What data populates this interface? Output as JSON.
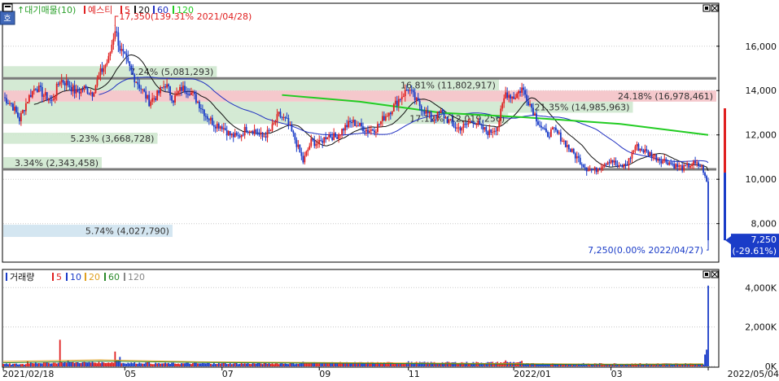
{
  "price_panel": {
    "legend_prefix": "↑대기매물(10)",
    "stock_name": "예스티",
    "legend_ma": [
      "5",
      "20",
      "60",
      "120"
    ],
    "high_label": "17,350(139.31% 2021/04/28)",
    "low_label": "7,250(0.00% 2022/04/27)",
    "last_price": "7,250",
    "last_change": "(-29.61%)",
    "corner_icon": "hoga-icon",
    "corner_label": "호"
  },
  "volume_panel": {
    "legend_title": "거래량",
    "legend_ma": [
      "5",
      "10",
      "20",
      "60",
      "120"
    ]
  },
  "colors": {
    "up": "#e02020",
    "down": "#1a3cc8",
    "ma5": "#e02020",
    "ma20": "#111111",
    "ma60": "#1f2fc0",
    "ma120": "#22cc22",
    "supply_band": "#cfe8cf",
    "supply_hot": "#f4c2c6",
    "supply_low": "#cfe3f0"
  },
  "chart_data": [
    {
      "type": "line",
      "panel": "price",
      "y_ticks": [
        8000,
        10000,
        12000,
        14000,
        16000
      ],
      "y_tick_labels": [
        "8,000",
        "10,000",
        "12,000",
        "14,000",
        "16,000"
      ],
      "ylim": [
        6300,
        17900
      ],
      "x_labels": [
        "2021/02/18",
        "05",
        "07",
        "09",
        "11",
        "2022/01",
        "03",
        "2022/05/04"
      ],
      "x_label_days": [
        0,
        75,
        135,
        195,
        250,
        315,
        375,
        435
      ],
      "x_range": [
        0,
        440
      ],
      "key_prices": [
        {
          "day": 0,
          "close": 13700
        },
        {
          "day": 5,
          "close": 13400
        },
        {
          "day": 10,
          "close": 12700
        },
        {
          "day": 15,
          "close": 13600
        },
        {
          "day": 20,
          "close": 14200
        },
        {
          "day": 25,
          "close": 13800
        },
        {
          "day": 30,
          "close": 13500
        },
        {
          "day": 35,
          "close": 14500
        },
        {
          "day": 40,
          "close": 14300
        },
        {
          "day": 45,
          "close": 13900
        },
        {
          "day": 50,
          "close": 14100
        },
        {
          "day": 55,
          "close": 13900
        },
        {
          "day": 60,
          "close": 14800
        },
        {
          "day": 65,
          "close": 15400
        },
        {
          "day": 69,
          "close": 16800
        },
        {
          "day": 72,
          "close": 15900
        },
        {
          "day": 76,
          "close": 15300
        },
        {
          "day": 80,
          "close": 14700
        },
        {
          "day": 85,
          "close": 14100
        },
        {
          "day": 90,
          "close": 13500
        },
        {
          "day": 95,
          "close": 13800
        },
        {
          "day": 100,
          "close": 14300
        },
        {
          "day": 105,
          "close": 13600
        },
        {
          "day": 110,
          "close": 14100
        },
        {
          "day": 115,
          "close": 14000
        },
        {
          "day": 120,
          "close": 13500
        },
        {
          "day": 125,
          "close": 12900
        },
        {
          "day": 130,
          "close": 12500
        },
        {
          "day": 135,
          "close": 12400
        },
        {
          "day": 140,
          "close": 12000
        },
        {
          "day": 145,
          "close": 11900
        },
        {
          "day": 150,
          "close": 12300
        },
        {
          "day": 155,
          "close": 12200
        },
        {
          "day": 160,
          "close": 11900
        },
        {
          "day": 165,
          "close": 12200
        },
        {
          "day": 170,
          "close": 12900
        },
        {
          "day": 175,
          "close": 12600
        },
        {
          "day": 180,
          "close": 11800
        },
        {
          "day": 185,
          "close": 10800
        },
        {
          "day": 190,
          "close": 11700
        },
        {
          "day": 195,
          "close": 11600
        },
        {
          "day": 200,
          "close": 12000
        },
        {
          "day": 205,
          "close": 11900
        },
        {
          "day": 210,
          "close": 12300
        },
        {
          "day": 215,
          "close": 12600
        },
        {
          "day": 220,
          "close": 12400
        },
        {
          "day": 225,
          "close": 12200
        },
        {
          "day": 230,
          "close": 12300
        },
        {
          "day": 235,
          "close": 12800
        },
        {
          "day": 240,
          "close": 13200
        },
        {
          "day": 245,
          "close": 13700
        },
        {
          "day": 250,
          "close": 14100
        },
        {
          "day": 255,
          "close": 13500
        },
        {
          "day": 260,
          "close": 13100
        },
        {
          "day": 265,
          "close": 12700
        },
        {
          "day": 270,
          "close": 13000
        },
        {
          "day": 275,
          "close": 12600
        },
        {
          "day": 280,
          "close": 12300
        },
        {
          "day": 285,
          "close": 12400
        },
        {
          "day": 290,
          "close": 12700
        },
        {
          "day": 295,
          "close": 12300
        },
        {
          "day": 300,
          "close": 12100
        },
        {
          "day": 305,
          "close": 12400
        },
        {
          "day": 310,
          "close": 13900
        },
        {
          "day": 315,
          "close": 13700
        },
        {
          "day": 320,
          "close": 14100
        },
        {
          "day": 325,
          "close": 13400
        },
        {
          "day": 330,
          "close": 12600
        },
        {
          "day": 335,
          "close": 12000
        },
        {
          "day": 340,
          "close": 12200
        },
        {
          "day": 345,
          "close": 11800
        },
        {
          "day": 350,
          "close": 11300
        },
        {
          "day": 355,
          "close": 10900
        },
        {
          "day": 360,
          "close": 10500
        },
        {
          "day": 365,
          "close": 10400
        },
        {
          "day": 370,
          "close": 10700
        },
        {
          "day": 375,
          "close": 10900
        },
        {
          "day": 380,
          "close": 10500
        },
        {
          "day": 385,
          "close": 10700
        },
        {
          "day": 390,
          "close": 11500
        },
        {
          "day": 395,
          "close": 11300
        },
        {
          "day": 400,
          "close": 11100
        },
        {
          "day": 405,
          "close": 10900
        },
        {
          "day": 410,
          "close": 10800
        },
        {
          "day": 415,
          "close": 10600
        },
        {
          "day": 420,
          "close": 10500
        },
        {
          "day": 425,
          "close": 10700
        },
        {
          "day": 430,
          "close": 10600
        },
        {
          "day": 432,
          "close": 10400
        },
        {
          "day": 434,
          "close": 9900
        },
        {
          "day": 435,
          "close": 7250
        }
      ],
      "ma120_segment": [
        {
          "day": 172,
          "value": 13800
        },
        {
          "day": 220,
          "value": 13500
        },
        {
          "day": 270,
          "value": 13000
        },
        {
          "day": 320,
          "value": 12800
        },
        {
          "day": 380,
          "value": 12500
        },
        {
          "day": 435,
          "value": 12000
        }
      ],
      "supply_levels": [
        {
          "price_low": 14600,
          "price_high": 15100,
          "pct": "7.24%",
          "amount": "(5,081,293)",
          "width_pct": 7.24
        },
        {
          "price_low": 14000,
          "price_high": 14500,
          "pct": "16.81%",
          "amount": "(11,802,917)",
          "width_pct": 16.81
        },
        {
          "price_low": 13500,
          "price_high": 14000,
          "pct": "24.18%",
          "amount": "(16,978,461)",
          "width_pct": 24.18,
          "highlight": "hot"
        },
        {
          "price_low": 13000,
          "price_high": 13500,
          "pct": "21.35%",
          "amount": "(14,985,963)",
          "width_pct": 21.35
        },
        {
          "price_low": 12500,
          "price_high": 13000,
          "pct": "17.12%",
          "amount": "(12,019,256)",
          "width_pct": 17.12
        },
        {
          "price_low": 11600,
          "price_high": 12100,
          "pct": "5.23%",
          "amount": "(3,668,728)",
          "width_pct": 5.23
        },
        {
          "price_low": 10500,
          "price_high": 11000,
          "pct": "3.34%",
          "amount": "(2,343,458)",
          "width_pct": 3.34
        },
        {
          "price_low": 7400,
          "price_high": 7950,
          "pct": "5.74%",
          "amount": "(4,027,790)",
          "width_pct": 5.74,
          "highlight": "low"
        }
      ],
      "guide_lines": [
        14550,
        10450
      ]
    },
    {
      "type": "bar",
      "panel": "volume",
      "y_ticks": [
        0,
        2000,
        4000
      ],
      "y_tick_labels": [
        "0K",
        "2,000K",
        "4,000K"
      ],
      "ylim": [
        0,
        4300
      ],
      "volume_k": [
        {
          "day": 0,
          "v": 120
        },
        {
          "day": 15,
          "v": 260
        },
        {
          "day": 20,
          "v": 230
        },
        {
          "day": 35,
          "v": 1350
        },
        {
          "day": 40,
          "v": 300
        },
        {
          "day": 55,
          "v": 260
        },
        {
          "day": 69,
          "v": 750
        },
        {
          "day": 72,
          "v": 480
        },
        {
          "day": 90,
          "v": 220
        },
        {
          "day": 130,
          "v": 180
        },
        {
          "day": 185,
          "v": 240
        },
        {
          "day": 250,
          "v": 260
        },
        {
          "day": 310,
          "v": 300
        },
        {
          "day": 320,
          "v": 280
        },
        {
          "day": 390,
          "v": 150
        },
        {
          "day": 433,
          "v": 600
        },
        {
          "day": 434,
          "v": 850
        },
        {
          "day": 435,
          "v": 4100
        }
      ]
    }
  ]
}
